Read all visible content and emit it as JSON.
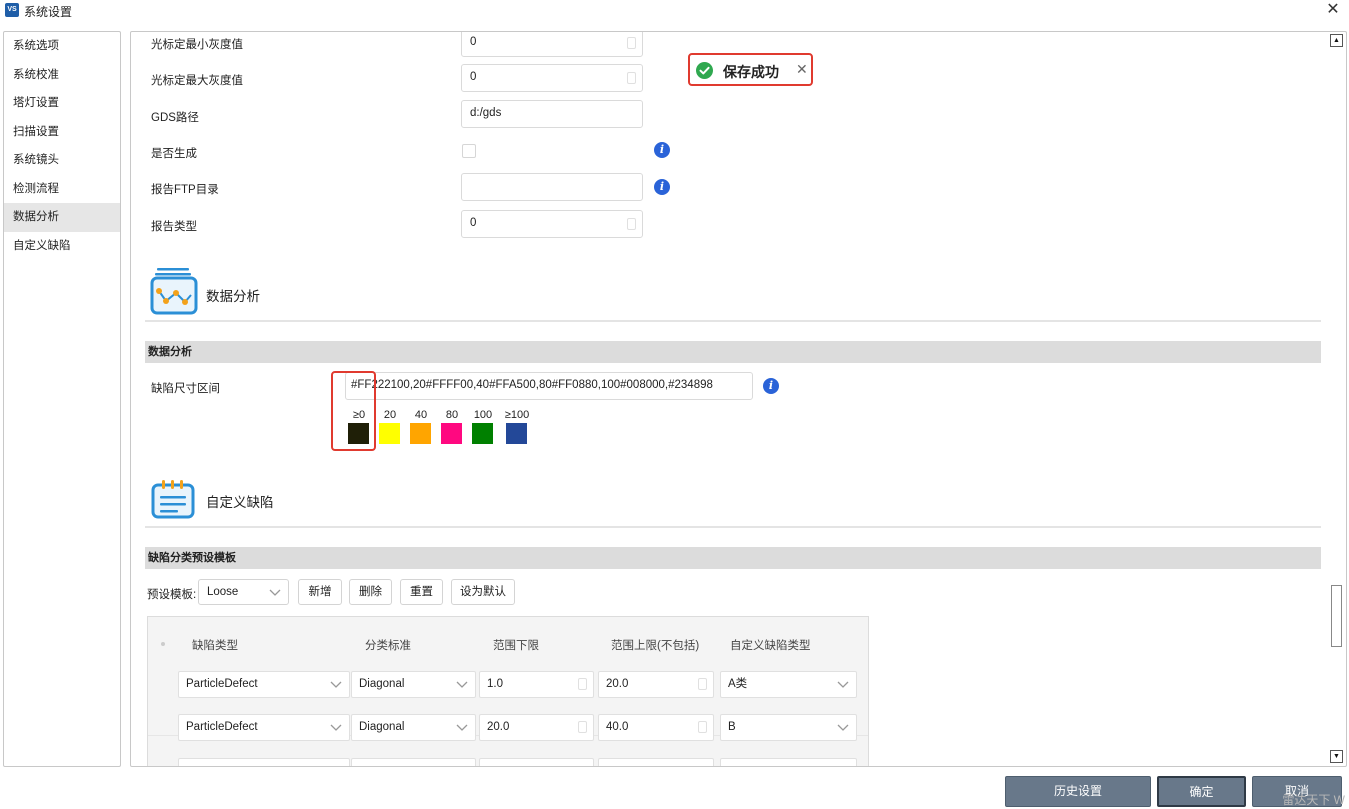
{
  "window": {
    "title": "系统设置",
    "app_badge": "VS",
    "close_glyph": "✕"
  },
  "sidebar": {
    "items": [
      {
        "label": "系统选项"
      },
      {
        "label": "系统校准"
      },
      {
        "label": "塔灯设置"
      },
      {
        "label": "扫描设置"
      },
      {
        "label": "系统镜头"
      },
      {
        "label": "检测流程"
      },
      {
        "label": "数据分析",
        "active": true
      },
      {
        "label": "自定义缺陷"
      }
    ]
  },
  "form": {
    "cursor_min_gray": {
      "label": "光标定最小灰度值",
      "value": "0"
    },
    "cursor_max_gray": {
      "label": "光标定最大灰度值",
      "value": "0"
    },
    "gds_path": {
      "label": "GDS路径",
      "value": "d:/gds"
    },
    "generate": {
      "label": "是否生成",
      "checked": false
    },
    "report_ftp": {
      "label": "报告FTP目录",
      "value": ""
    },
    "report_type": {
      "label": "报告类型",
      "value": "0"
    }
  },
  "toast": {
    "text": "保存成功",
    "close_glyph": "✕",
    "color": "#2fa84f"
  },
  "data_analysis": {
    "section_title": "数据分析",
    "bar_title": "数据分析",
    "defect_size_label": "缺陷尺寸区间",
    "defect_size_value": "#FF222100,20#FFFF00,40#FFA500,80#FF0880,100#008000,#234898",
    "legend": [
      {
        "label": "≥0",
        "color": "#1f1f07"
      },
      {
        "label": "20",
        "color": "#ffff00"
      },
      {
        "label": "40",
        "color": "#ffa500"
      },
      {
        "label": "80",
        "color": "#ff0880"
      },
      {
        "label": "100",
        "color": "#008000"
      },
      {
        "label": "≥100",
        "color": "#234898"
      }
    ]
  },
  "custom_defect": {
    "section_title": "自定义缺陷",
    "bar_title": "缺陷分类预设模板",
    "template_label": "预设模板:",
    "template_value": "Loose",
    "buttons": {
      "add": "新增",
      "delete": "删除",
      "reset": "重置",
      "set_default": "设为默认"
    },
    "columns": [
      "缺陷类型",
      "分类标准",
      "范围下限",
      "范围上限(不包括)",
      "自定义缺陷类型"
    ],
    "rows": [
      {
        "defect_type": "ParticleDefect",
        "criterion": "Diagonal",
        "lower": "1.0",
        "upper": "20.0",
        "custom_type": "A类"
      },
      {
        "defect_type": "ParticleDefect",
        "criterion": "Diagonal",
        "lower": "20.0",
        "upper": "40.0",
        "custom_type": "B"
      }
    ]
  },
  "footer": {
    "history": "历史设置",
    "ok": "确定",
    "cancel": "取消"
  },
  "watermark": "雷达天下 W",
  "scrollbar": {
    "up_glyph": "▲",
    "down_glyph": "▼"
  },
  "colors": {
    "accent_red": "#e03a2f",
    "info_blue": "#2a63d8",
    "footer_button": "#68788a"
  }
}
